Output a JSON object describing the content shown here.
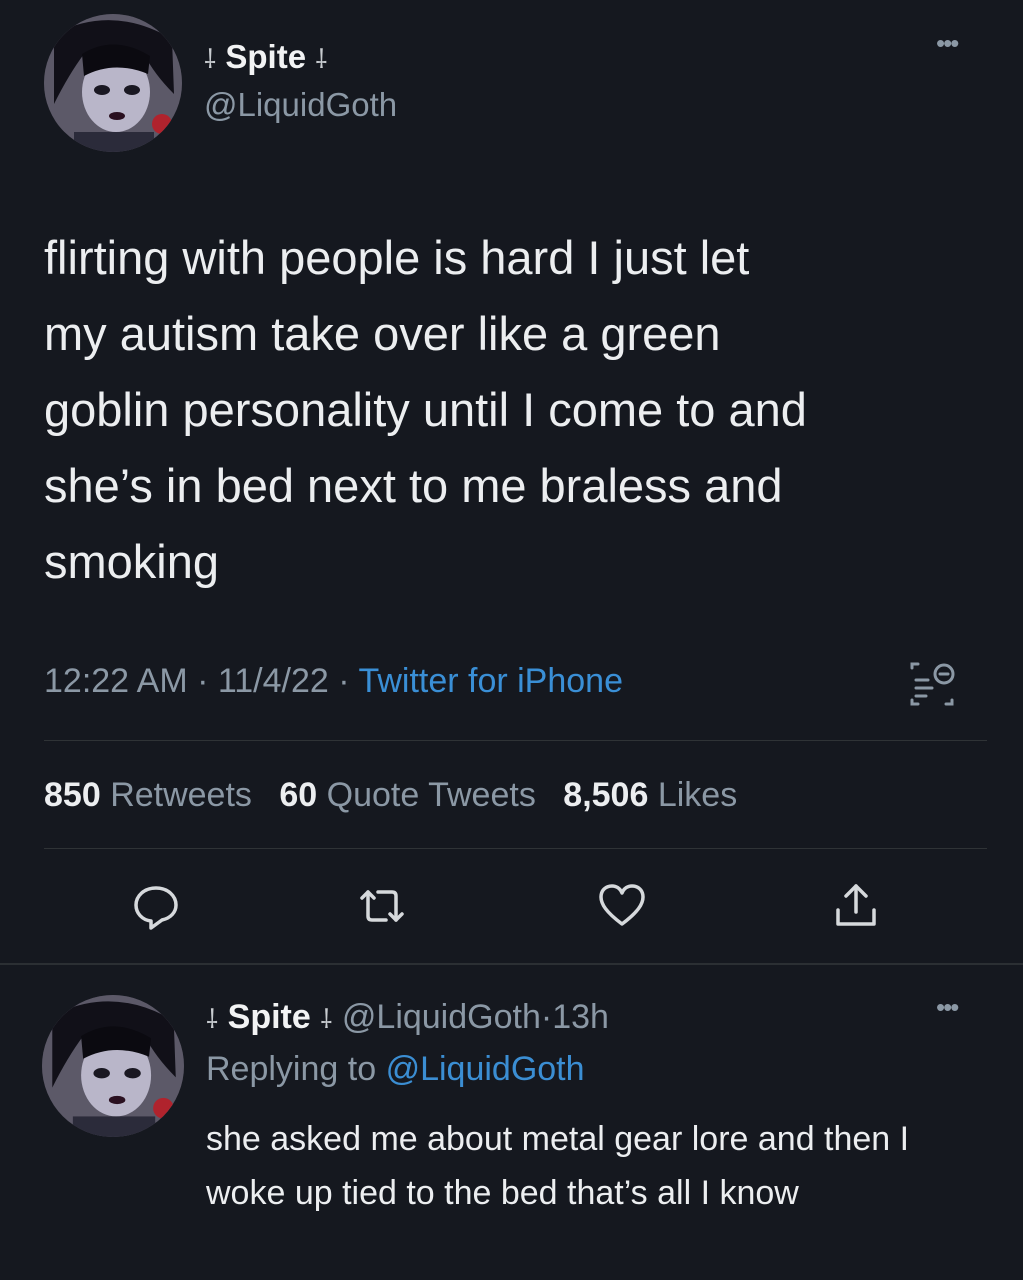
{
  "tweet": {
    "display_name": "Spite",
    "name_decoration": "⸸",
    "handle": "@LiquidGoth",
    "text": "flirting with people is hard I just let\nmy autism take over like a green\ngoblin personality until I come to and\nshe’s in bed next to me braless and\nsmoking",
    "time": "12:22 AM",
    "date": "11/4/22",
    "separator": "·",
    "source": "Twitter for iPhone",
    "stats": {
      "retweets_count": "850",
      "retweets_label": "Retweets",
      "quotes_count": "60",
      "quotes_label": "Quote Tweets",
      "likes_count": "8,506",
      "likes_label": "Likes"
    },
    "actions": [
      "reply-icon",
      "retweet-icon",
      "like-icon",
      "share-icon"
    ],
    "more_label": "•••"
  },
  "reply": {
    "display_name": "Spite",
    "name_decoration": "⸸",
    "handle": "@LiquidGoth",
    "age": "13h",
    "separator": "·",
    "replying_to_label": "Replying to",
    "replying_to_handle": "@LiquidGoth",
    "text": "she asked me about metal gear lore and then I woke up tied to the bed that’s all I know",
    "more_label": "•••"
  },
  "colors": {
    "background": "#15181f",
    "text": "#e7e9ea",
    "muted": "#8b98a5",
    "link": "#3a8fd6"
  }
}
